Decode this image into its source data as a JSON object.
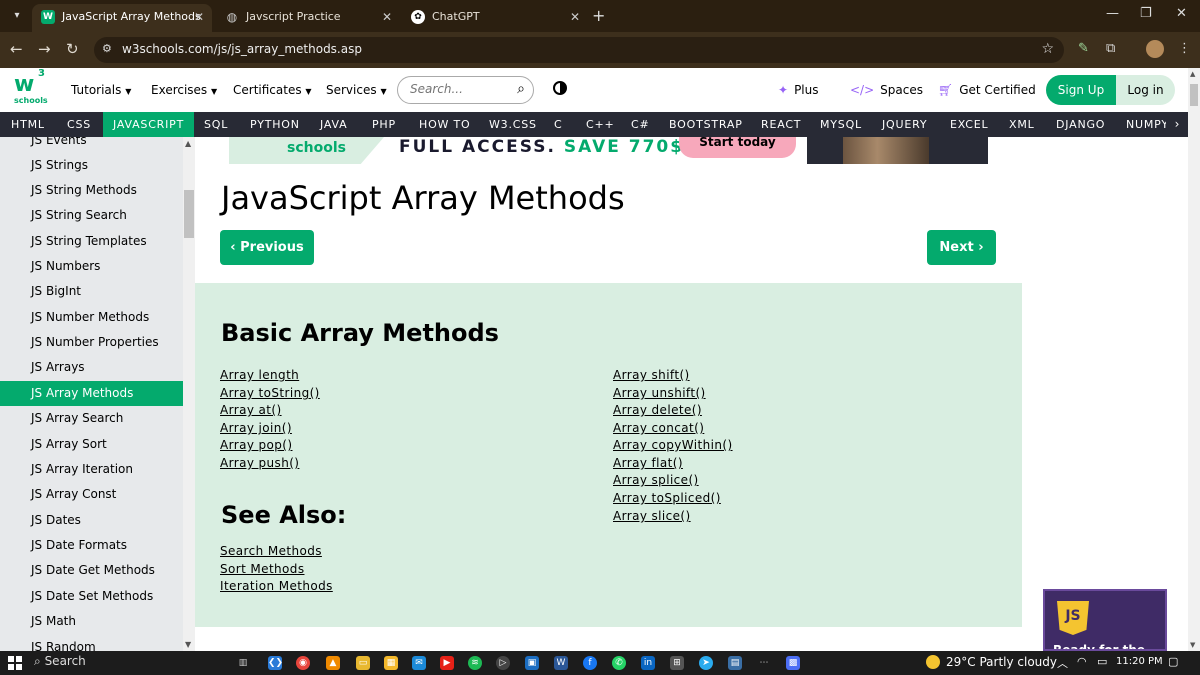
{
  "browser": {
    "tabs": [
      {
        "title": "JavaScript Array Methods",
        "icon": "w3schools-favicon",
        "active": true
      },
      {
        "title": "Javscript Practice",
        "icon": "globe-icon",
        "active": false
      },
      {
        "title": "ChatGPT",
        "icon": "chatgpt-icon",
        "active": false
      }
    ],
    "url": "w3schools.com/js/js_array_methods.asp"
  },
  "header": {
    "logo_number": "3",
    "logo_text": "schools",
    "nav": [
      "Tutorials",
      "Exercises",
      "Certificates",
      "Services"
    ],
    "search_placeholder": "Search...",
    "plus_label": "Plus",
    "spaces_label": "Spaces",
    "certified_label": "Get Certified",
    "signup_label": "Sign Up",
    "login_label": "Log in"
  },
  "lang_bar": {
    "items": [
      "HTML",
      "CSS",
      "JAVASCRIPT",
      "SQL",
      "PYTHON",
      "JAVA",
      "PHP",
      "HOW TO",
      "W3.CSS",
      "C",
      "C++",
      "C#",
      "BOOTSTRAP",
      "REACT",
      "MYSQL",
      "JQUERY",
      "EXCEL",
      "XML",
      "DJANGO",
      "NUMPY"
    ],
    "active": "JAVASCRIPT"
  },
  "sidebar": {
    "items": [
      "JS Events",
      "JS Strings",
      "JS String Methods",
      "JS String Search",
      "JS String Templates",
      "JS Numbers",
      "JS BigInt",
      "JS Number Methods",
      "JS Number Properties",
      "JS Arrays",
      "JS Array Methods",
      "JS Array Search",
      "JS Array Sort",
      "JS Array Iteration",
      "JS Array Const",
      "JS Dates",
      "JS Date Formats",
      "JS Date Get Methods",
      "JS Date Set Methods",
      "JS Math",
      "JS Random"
    ],
    "active": "JS Array Methods"
  },
  "ad": {
    "brand": "schools",
    "headline_a": "FULL ACCESS.",
    "headline_b": "SAVE 770$",
    "cta": "Start today"
  },
  "main": {
    "title": "JavaScript Array Methods",
    "prev_label": "Previous",
    "next_label": "Next",
    "basic_title": "Basic Array Methods",
    "left_links": [
      "Array length",
      "Array toString()",
      "Array at()",
      "Array join()",
      "Array pop()",
      "Array push()"
    ],
    "right_links": [
      "Array shift()",
      "Array unshift()",
      "Array delete()",
      "Array concat()",
      "Array copyWithin()",
      "Array flat()",
      "Array splice()",
      "Array toSpliced()",
      "Array slice()"
    ],
    "see_also_title": "See Also:",
    "see_also_links": [
      "Search Methods",
      "Sort Methods",
      "Iteration Methods"
    ]
  },
  "side_ad": {
    "badge": "JS",
    "text": "Ready for the"
  },
  "taskbar": {
    "search_label": "Search",
    "weather": "29°C  Partly cloudy",
    "time": "11:20 PM"
  },
  "colors": {
    "brand_green": "#04aa6d",
    "panel_green": "#d9eee1",
    "lang_bar": "#282a35",
    "chrome_dark": "#3d2f1c"
  }
}
